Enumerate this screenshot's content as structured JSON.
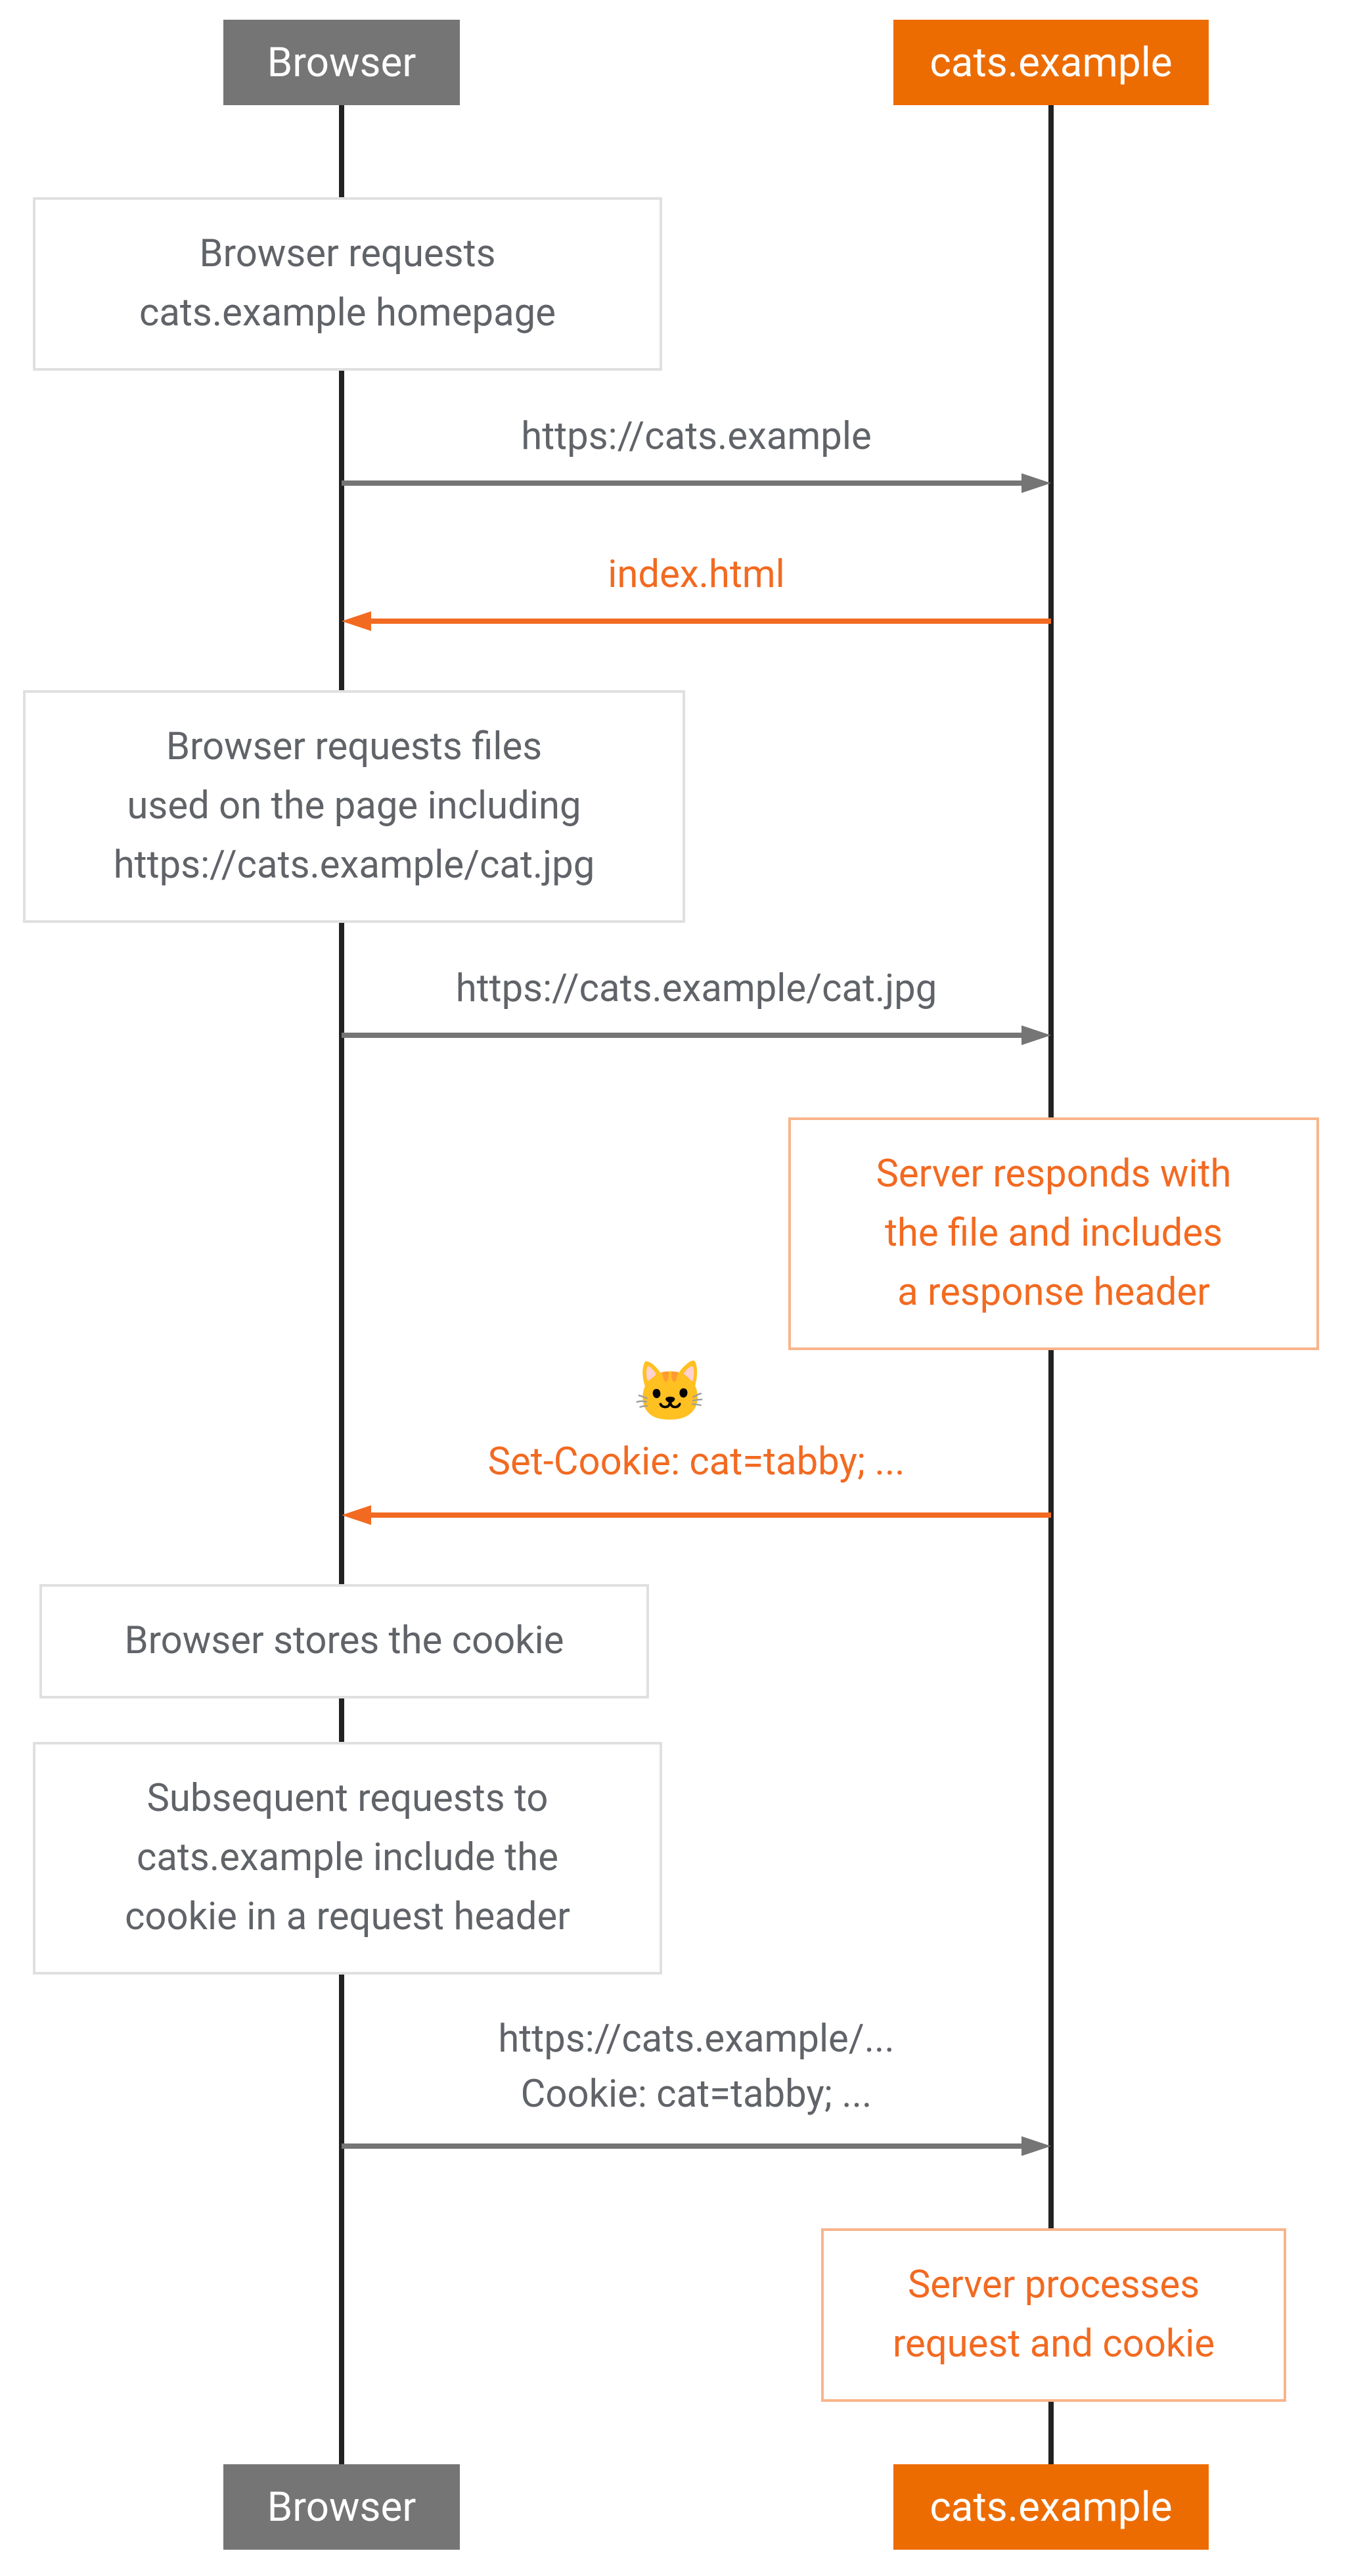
{
  "participants": {
    "browser": "Browser",
    "server": "cats.example"
  },
  "notes": {
    "n1": "Browser requests\ncats.example homepage",
    "n2": "Browser requests files\nused on the page including\nhttps://cats.example/cat.jpg",
    "n3": "Server responds with\nthe file and includes\na response header",
    "n4": "Browser stores the cookie",
    "n5": "Subsequent requests to\ncats.example include the\ncookie in a request header",
    "n6": "Server processes\nrequest and cookie"
  },
  "messages": {
    "m1": "https://cats.example",
    "m2": "index.html",
    "m3": "https://cats.example/cat.jpg",
    "m4_emoji": "🐱",
    "m4": "Set-Cookie: cat=tabby; ...",
    "m5": "https://cats.example/...\nCookie: cat=tabby; ..."
  }
}
